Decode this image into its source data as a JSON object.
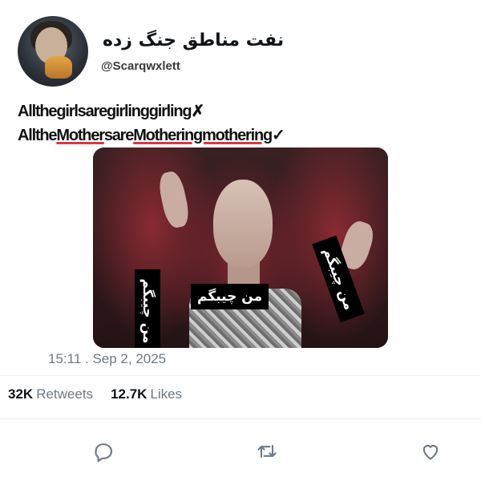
{
  "tweet": {
    "display_name": "نفت مناطق جنگ زده",
    "handle": "@Scarqwxlett",
    "text_line1_a": "Allthegirlsaregirlinggirling",
    "text_line1_mark": "✗",
    "text_line2_a": "Allthe",
    "text_line2_h1": "Mother",
    "text_line2_b": "sare",
    "text_line2_h2": "Motheringmothering",
    "text_line2_mark": "✓",
    "media": {
      "caption_left": "من چیبگم",
      "caption_center": "من چیبگم",
      "caption_right": "من چیبگم"
    },
    "timestamp": "15:11 . Sep 2, 2025"
  },
  "stats": {
    "retweets_count": "32K",
    "retweets_label": "Retweets",
    "likes_count": "12.7K",
    "likes_label": "Likes"
  },
  "actions": [
    "reply-icon",
    "retweet-icon",
    "like-icon"
  ],
  "colors": {
    "highlight_underline": "#e0343f",
    "muted_text": "#6e7a86"
  }
}
